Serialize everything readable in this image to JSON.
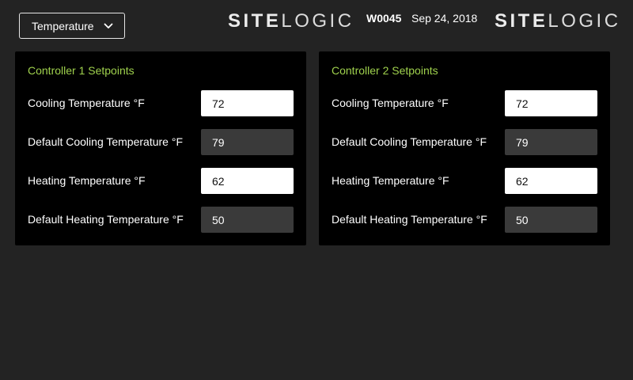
{
  "header": {
    "dropdown": {
      "selected": "Temperature"
    },
    "logo_left": {
      "bold": "SITE",
      "light": "LOGIC"
    },
    "site_id": "W0045",
    "date": "Sep 24, 2018",
    "logo_right": {
      "bold": "SITE",
      "light": "LOGIC"
    }
  },
  "controllers": [
    {
      "title": "Controller 1 Setpoints",
      "rows": [
        {
          "label": "Cooling Temperature °F",
          "value": "72"
        },
        {
          "label": "Default Cooling Temperature °F",
          "value": "79"
        },
        {
          "label": "Heating Temperature °F",
          "value": "62"
        },
        {
          "label": "Default Heating Temperature °F",
          "value": "50"
        }
      ]
    },
    {
      "title": "Controller 2 Setpoints",
      "rows": [
        {
          "label": "Cooling Temperature °F",
          "value": "72"
        },
        {
          "label": "Default Cooling Temperature °F",
          "value": "79"
        },
        {
          "label": "Heating Temperature °F",
          "value": "62"
        },
        {
          "label": "Default Heating Temperature °F",
          "value": "50"
        }
      ]
    }
  ],
  "colors": {
    "background": "#232323",
    "panel": "#000000",
    "accent_title": "#9fd14d",
    "editable_field": "#ffffff",
    "readonly_field": "#3a3a3a"
  },
  "icons": {
    "dropdown": "chevron-down-icon"
  }
}
